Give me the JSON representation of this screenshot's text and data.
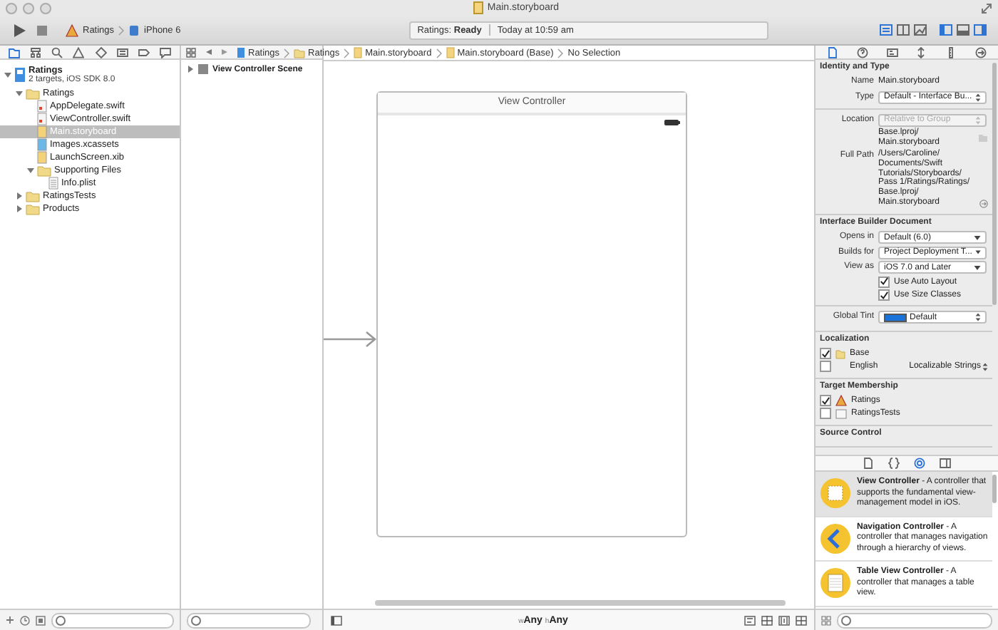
{
  "window": {
    "title": "Main.storyboard"
  },
  "toolbar": {
    "scheme": "Ratings",
    "device": "iPhone 6",
    "status": "Ratings: **Ready**",
    "time": "Today at 10:59 am",
    "editor_modes": [
      {
        "selected": true
      },
      {
        "selected": false
      },
      {
        "selected": false
      }
    ],
    "panels": [
      {
        "on": true
      },
      {
        "on": false
      },
      {
        "on": true
      }
    ]
  },
  "navigator_tabs": [
    {
      "selected": true
    },
    {
      "selected": false
    },
    {
      "selected": false
    },
    {
      "selected": false
    },
    {
      "selected": false
    },
    {
      "selected": false
    },
    {
      "selected": false
    },
    {
      "selected": false
    }
  ],
  "jump_bar": [
    "Ratings",
    "Ratings",
    "Main.storyboard",
    "Main.storyboard (Base)",
    "No Selection"
  ],
  "navigator": [
    {
      "name": "Ratings",
      "subtitle": "2 targets, iOS SDK 8.0",
      "kind": "project",
      "expanded": true,
      "selected": false,
      "children": [
        {
          "name": "Ratings",
          "kind": "folder",
          "expanded": true,
          "selected": false,
          "children": [
            {
              "name": "AppDelegate.swift",
              "kind": "swift",
              "selected": false
            },
            {
              "name": "ViewController.swift",
              "kind": "swift",
              "selected": false
            },
            {
              "name": "Main.storyboard",
              "kind": "storyboard",
              "selected": true
            },
            {
              "name": "Images.xcassets",
              "kind": "assets",
              "selected": false
            },
            {
              "name": "LaunchScreen.xib",
              "kind": "xib",
              "selected": false
            },
            {
              "name": "Supporting Files",
              "kind": "folder",
              "expanded": true,
              "selected": false,
              "children": [
                {
                  "name": "Info.plist",
                  "kind": "plist",
                  "selected": false
                }
              ]
            }
          ]
        },
        {
          "name": "RatingsTests",
          "kind": "folder",
          "expanded": false,
          "selected": false
        },
        {
          "name": "Products",
          "kind": "folder",
          "expanded": false,
          "selected": false
        }
      ]
    }
  ],
  "outline": [
    {
      "name": "View Controller Scene",
      "expanded": false
    }
  ],
  "canvas": {
    "scene_title": "View Controller",
    "size_class": [
      {
        "prefix": "w",
        "value": "Any"
      },
      {
        "prefix": "h",
        "value": "Any"
      }
    ]
  },
  "inspector_tabs": [
    {
      "selected": true
    },
    {
      "selected": false
    },
    {
      "selected": false
    },
    {
      "selected": false
    },
    {
      "selected": false
    },
    {
      "selected": false
    }
  ],
  "inspector": [
    {
      "heading": "Identity and Type",
      "rows": [
        {
          "kind": "text",
          "label": "Name",
          "value": "Main.storyboard"
        },
        {
          "kind": "popup",
          "label": "Type",
          "value": "Default - Interface Bu..."
        },
        {
          "kind": "divider"
        },
        {
          "kind": "disabled",
          "label": "Location",
          "value": "Relative to Group"
        },
        {
          "kind": "path",
          "value": "Base.lproj/\nMain.storyboard"
        },
        {
          "kind": "fullpath",
          "label": "Full Path",
          "value": "/Users/Caroline/\nDocuments/Swift\nTutorials/Storyboards/\nPass 1/Ratings/Ratings/\nBase.lproj/\nMain.storyboard"
        }
      ]
    },
    {
      "heading": "Interface Builder Document",
      "rows": [
        {
          "kind": "menu",
          "label": "Opens in",
          "value": "Default (6.0)"
        },
        {
          "kind": "menu",
          "label": "Builds for",
          "value": "Project Deployment T..."
        },
        {
          "kind": "menu",
          "label": "View as",
          "value": "iOS 7.0 and Later"
        },
        {
          "kind": "check",
          "value": "Use Auto Layout",
          "checked": true
        },
        {
          "kind": "check",
          "value": "Use Size Classes",
          "checked": true
        },
        {
          "kind": "divider"
        },
        {
          "kind": "tint",
          "label": "Global Tint",
          "value": "Default",
          "color": "#1a73d9"
        }
      ]
    },
    {
      "heading": "Localization",
      "rows": [
        {
          "kind": "loc",
          "value": "Base",
          "checked": true
        },
        {
          "kind": "loc",
          "value": "English",
          "checked": false,
          "extra": "Localizable Strings"
        }
      ]
    },
    {
      "heading": "Target Membership",
      "rows": [
        {
          "kind": "loc",
          "value": "Ratings",
          "checked": true
        },
        {
          "kind": "loc",
          "value": "RatingsTests",
          "checked": false
        }
      ]
    },
    {
      "heading": "Source Control"
    }
  ],
  "library_tabs": [
    {
      "selected": false
    },
    {
      "selected": false
    },
    {
      "selected": true
    },
    {
      "selected": false
    }
  ],
  "library": [
    {
      "text": "**View Controller** - A controller that supports the fundamental view-management model in iOS.",
      "kind": "view",
      "selected": true
    },
    {
      "text": "**Navigation Controller** - A controller that manages navigation through a hierarchy of views.",
      "kind": "navigation",
      "selected": false
    },
    {
      "text": "**Table View Controller** - A controller that manages a table view.",
      "kind": "table",
      "selected": false
    }
  ]
}
